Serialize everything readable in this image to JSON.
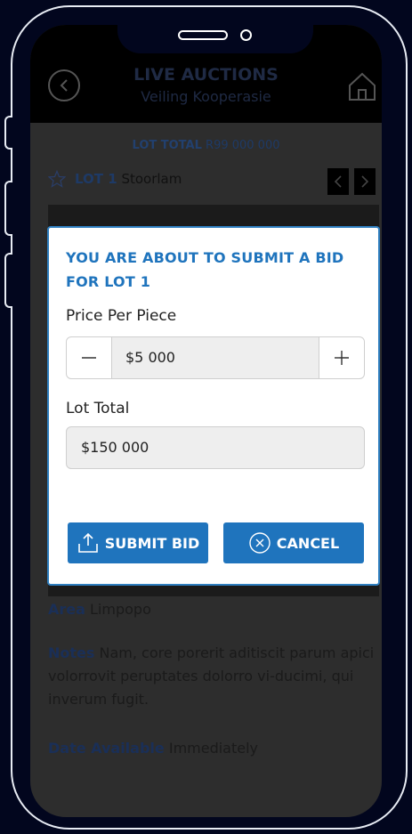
{
  "header": {
    "title": "LIVE AUCTIONS",
    "subtitle": "Veiling Kooperasie"
  },
  "lot_summary": {
    "total_label": "LOT TOTAL",
    "total_value": "R99 000 000"
  },
  "lot": {
    "number_label": "LOT 1",
    "name": "Stoorlam"
  },
  "details": {
    "area_label": "Area",
    "area_value": "Limpopo",
    "notes_label": "Notes",
    "notes_value": "Nam, core porerit aditiscit parum apici volorrovit peruptates dolorro vi-ducimi, qui inverum fugit.",
    "available_label": "Date Available",
    "available_value": "Immediately"
  },
  "modal": {
    "title": "YOU ARE ABOUT TO SUBMIT A BID FOR LOT 1",
    "price_label": "Price Per Piece",
    "price_value": "$5 000",
    "total_label": "Lot Total",
    "total_value": "$150 000",
    "submit_label": "SUBMIT BID",
    "cancel_label": "CANCEL"
  },
  "colors": {
    "accent": "#1f74bd",
    "background": "#02061e",
    "frame": "#e8ecf4"
  }
}
